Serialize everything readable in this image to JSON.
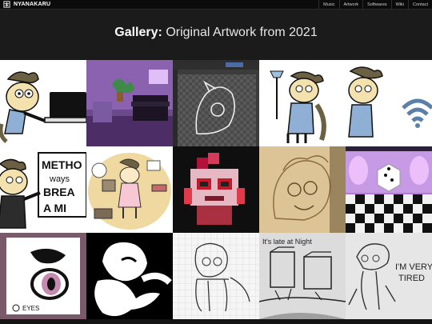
{
  "site": {
    "name": "NYANAKARU",
    "logo_icon": "cat-kanji-icon"
  },
  "nav": [
    "Music",
    "Artwork",
    "Softwares",
    "Wiki",
    "Contact"
  ],
  "page": {
    "heading_bold": "Gallery:",
    "heading_rest": "Original Artwork from 2021"
  },
  "gallery": {
    "tiles": [
      {
        "subject": "Pony with brown mane playing piano"
      },
      {
        "subject": "Purple room with piano and plant"
      },
      {
        "subject": "Line drawing on checkerboard canvas"
      },
      {
        "subject": "Pony holding a lamp"
      },
      {
        "subject": "Pony with wifi signal"
      },
      {
        "subject": "Pony with METHOD sign",
        "text": [
          "METHO",
          "ways",
          "BREA",
          "A MI"
        ]
      },
      {
        "subject": "Pony surrounded by objects"
      },
      {
        "subject": "Pixel art red pony"
      },
      {
        "subject": "Pony sketch on photo"
      },
      {
        "subject": "Dice on checkered floor"
      },
      {
        "subject": "Eyes drawing",
        "text": [
          "EYES"
        ]
      },
      {
        "subject": "Black and white pony"
      },
      {
        "subject": "Pony sketch on grid paper"
      },
      {
        "subject": "Ink sketch of a room",
        "text": [
          "It's late at Night"
        ]
      },
      {
        "subject": "Tired pony sketch",
        "text": [
          "I'M VERY",
          "TIRED"
        ]
      }
    ]
  },
  "colors": {
    "background": "#141414",
    "hero": "#1b1b1b",
    "topbar": "#0b0b0b"
  }
}
